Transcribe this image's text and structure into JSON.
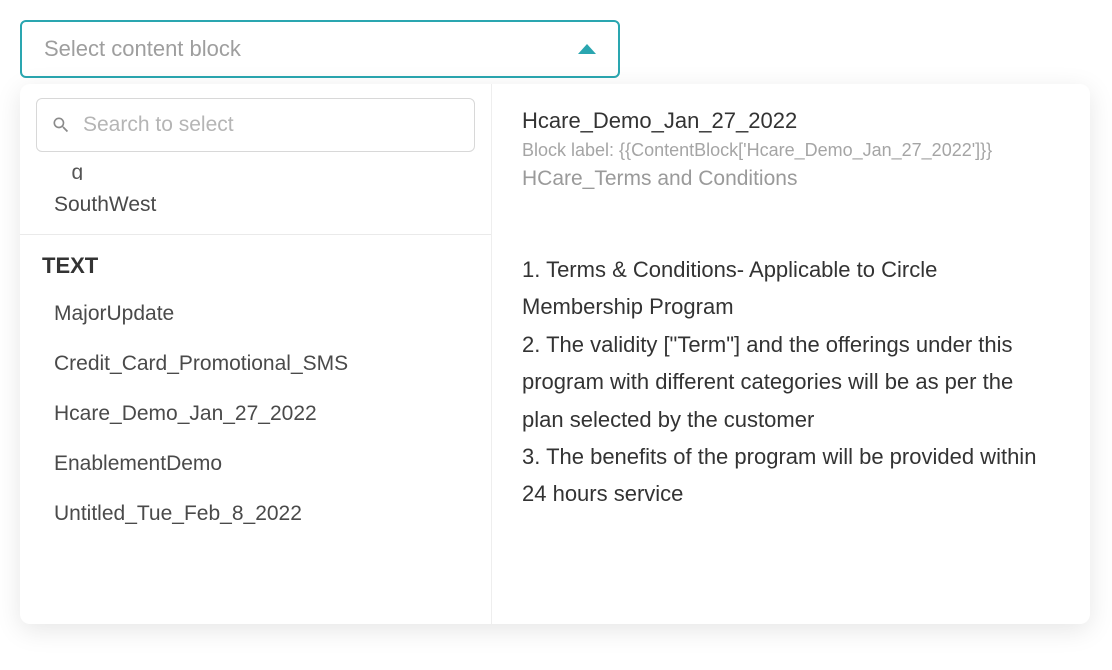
{
  "dropdown": {
    "placeholder": "Select content block",
    "search_placeholder": "Search to select"
  },
  "left_panel": {
    "cutoff_item": "_ g",
    "top_items": [
      "SouthWest"
    ],
    "section_label": "TEXT",
    "text_items": [
      "MajorUpdate",
      "Credit_Card_Promotional_SMS",
      "Hcare_Demo_Jan_27_2022",
      "EnablementDemo",
      "Untitled_Tue_Feb_8_2022"
    ]
  },
  "preview": {
    "title": "Hcare_Demo_Jan_27_2022",
    "block_label": "Block label: {{ContentBlock['Hcare_Demo_Jan_27_2022']}}",
    "subtitle": "HCare_Terms and Conditions",
    "body_line1": "1. Terms & Conditions- Applicable to Circle Membership Program",
    "body_line2": "2. The validity [\"Term\"] and the offerings under this program with different categories will be as per the plan selected by the customer",
    "body_line3": "3. The benefits of the program will be provided within 24 hours service"
  }
}
